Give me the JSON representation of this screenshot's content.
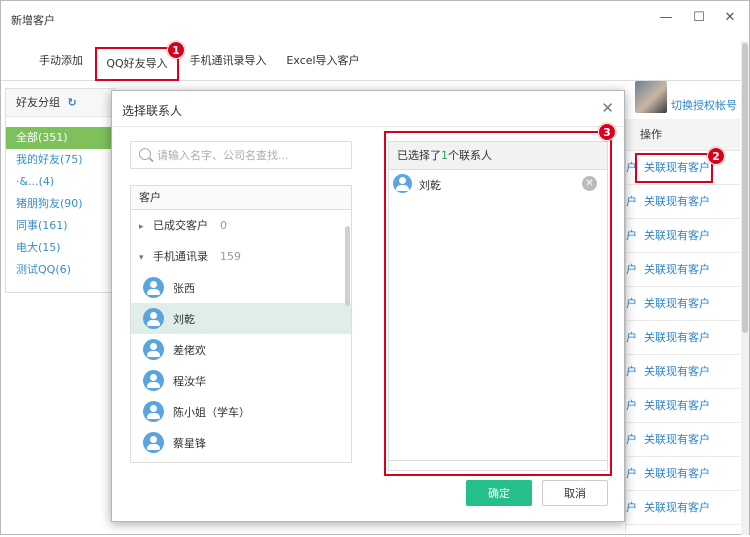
{
  "window": {
    "title": "新增客户",
    "minimize": "—",
    "maximize": "☐",
    "close": "✕"
  },
  "tabs": [
    {
      "label": "手动添加"
    },
    {
      "label": "QQ好友导入"
    },
    {
      "label": "手机通讯录导入"
    },
    {
      "label": "Excel导入客户"
    }
  ],
  "badges": [
    "1",
    "2",
    "3"
  ],
  "left_panel": {
    "header": "好友分组",
    "refresh_icon": "↻",
    "items": [
      "全部(351)",
      "我的好友(75)",
      "·&...(4)",
      "猪朋狗友(90)",
      "同事(161)",
      "电大(15)",
      "测试QQ(6)"
    ]
  },
  "account": {
    "switch_label": "切换授权帐号"
  },
  "right_table": {
    "header": "操作",
    "tick": "户",
    "link": "关联现有客户",
    "rows": 11
  },
  "dialog": {
    "title": "选择联系人",
    "close": "✕",
    "search_placeholder": "请输入名字、公司名查找...",
    "tree_header": "客户",
    "groups": [
      {
        "arrow": "▸",
        "label": "已成交客户",
        "count": "0"
      },
      {
        "arrow": "▾",
        "label": "手机通讯录",
        "count": "159"
      }
    ],
    "contacts": [
      "张西",
      "刘乾",
      "差佬欢",
      "程汝华",
      "陈小姐（学车）",
      "蔡星锋"
    ],
    "selected_panel": {
      "prefix": "已选择了",
      "count": "1",
      "suffix": "个联系人",
      "items": [
        "刘乾"
      ],
      "remove_icon": "✕"
    },
    "ok_label": "确定",
    "cancel_label": "取消"
  }
}
